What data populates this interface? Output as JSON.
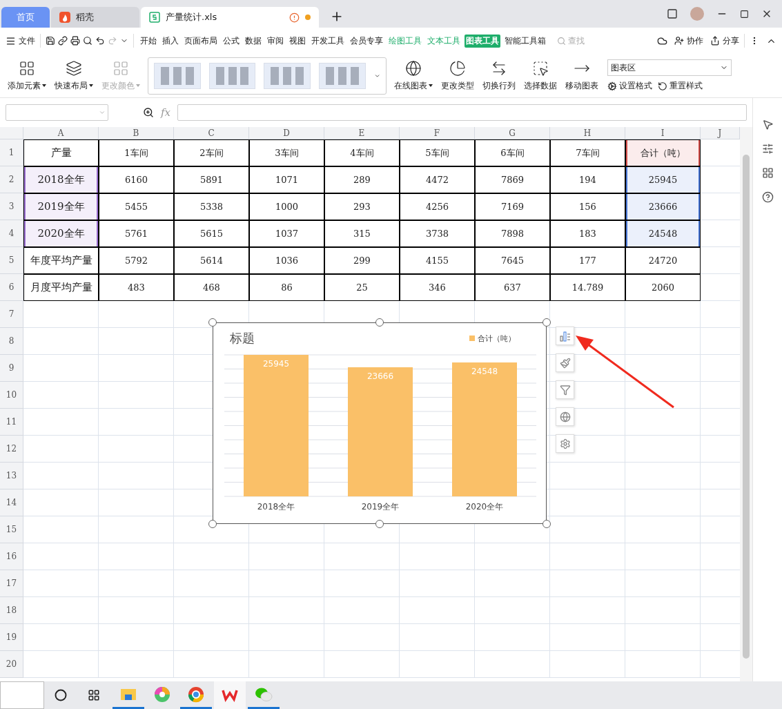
{
  "tabs": [
    {
      "label": "首页",
      "kind": "home",
      "selected": false
    },
    {
      "label": "稻壳",
      "kind": "app",
      "selected": false
    },
    {
      "label": "产量统计.xls",
      "kind": "document",
      "selected": true,
      "modified": true
    }
  ],
  "menu": {
    "file": "文件",
    "items": [
      {
        "label": "开始",
        "kind": "normal",
        "selected": false
      },
      {
        "label": "插入",
        "kind": "normal",
        "selected": false
      },
      {
        "label": "页面布局",
        "kind": "normal",
        "selected": false
      },
      {
        "label": "公式",
        "kind": "normal",
        "selected": false
      },
      {
        "label": "数据",
        "kind": "normal",
        "selected": false
      },
      {
        "label": "审阅",
        "kind": "normal",
        "selected": false
      },
      {
        "label": "视图",
        "kind": "normal",
        "selected": false
      },
      {
        "label": "开发工具",
        "kind": "normal",
        "selected": false
      },
      {
        "label": "会员专享",
        "kind": "normal",
        "selected": false
      },
      {
        "label": "绘图工具",
        "kind": "context",
        "selected": false
      },
      {
        "label": "文本工具",
        "kind": "context",
        "selected": false
      },
      {
        "label": "图表工具",
        "kind": "context",
        "selected": true
      },
      {
        "label": "智能工具箱",
        "kind": "normal",
        "selected": false
      }
    ],
    "search": {
      "placeholder": "查找"
    },
    "actions": [
      "协作",
      "分享"
    ]
  },
  "ribbon": [
    {
      "kind": "large",
      "label": "添加元素",
      "dropdown": true,
      "disabled": false
    },
    {
      "kind": "large",
      "label": "快速布局",
      "dropdown": true,
      "disabled": false
    },
    {
      "kind": "large",
      "label": "更改颜色",
      "dropdown": true,
      "disabled": true
    },
    {
      "kind": "gallery"
    },
    {
      "kind": "large",
      "label": "在线图表",
      "dropdown": true,
      "disabled": false
    },
    {
      "kind": "large",
      "label": "更改类型",
      "dropdown": false,
      "disabled": false
    },
    {
      "kind": "large",
      "label": "切换行列",
      "dropdown": false,
      "disabled": false
    },
    {
      "kind": "large",
      "label": "选择数据",
      "dropdown": false,
      "disabled": false
    },
    {
      "kind": "large",
      "label": "移动图表",
      "dropdown": false,
      "disabled": false
    },
    {
      "kind": "format",
      "select": "图表区",
      "buttons": [
        "设置格式",
        "重置样式"
      ]
    }
  ],
  "formula_bar": {
    "fx": "fx"
  },
  "sheet": {
    "columns": [
      "A",
      "B",
      "C",
      "D",
      "E",
      "F",
      "G",
      "H",
      "I",
      "J"
    ],
    "rows": [
      {
        "number": "1",
        "cells": [
          {
            "text": "产量"
          },
          {
            "text": "1车间"
          },
          {
            "text": "2车间"
          },
          {
            "text": "3车间"
          },
          {
            "text": "4车间"
          },
          {
            "text": "5车间"
          },
          {
            "text": "6车间"
          },
          {
            "text": "7车间"
          },
          {
            "text": "合计（吨）",
            "color": "#d9534f"
          }
        ]
      },
      {
        "number": "2",
        "cells": [
          {
            "text": "2018全年",
            "color": "#9c6fd3"
          },
          {
            "text": "6160"
          },
          {
            "text": "5891"
          },
          {
            "text": "1071"
          },
          {
            "text": "289"
          },
          {
            "text": "4472"
          },
          {
            "text": "7869"
          },
          {
            "text": "194"
          },
          {
            "text": "25945",
            "color": "#4a78d8"
          }
        ]
      },
      {
        "number": "3",
        "cells": [
          {
            "text": "2019全年",
            "color": "#9c6fd3"
          },
          {
            "text": "5455"
          },
          {
            "text": "5338"
          },
          {
            "text": "1000"
          },
          {
            "text": "293"
          },
          {
            "text": "4256"
          },
          {
            "text": "7169"
          },
          {
            "text": "156"
          },
          {
            "text": "23666",
            "color": "#4a78d8"
          }
        ]
      },
      {
        "number": "4",
        "cells": [
          {
            "text": "2020全年",
            "color": "#9c6fd3"
          },
          {
            "text": "5761"
          },
          {
            "text": "5615"
          },
          {
            "text": "1037"
          },
          {
            "text": "315"
          },
          {
            "text": "3738"
          },
          {
            "text": "7898"
          },
          {
            "text": "183"
          },
          {
            "text": "24548",
            "color": "#4a78d8"
          }
        ]
      },
      {
        "number": "5",
        "cells": [
          {
            "text": "年度平均产量"
          },
          {
            "text": "5792"
          },
          {
            "text": "5614"
          },
          {
            "text": "1036"
          },
          {
            "text": "299"
          },
          {
            "text": "4155"
          },
          {
            "text": "7645"
          },
          {
            "text": "177"
          },
          {
            "text": "24720"
          }
        ]
      },
      {
        "number": "6",
        "cells": [
          {
            "text": "月度平均产量"
          },
          {
            "text": "483"
          },
          {
            "text": "468"
          },
          {
            "text": "86"
          },
          {
            "text": "25"
          },
          {
            "text": "346"
          },
          {
            "text": "637"
          },
          {
            "text": "14.789"
          },
          {
            "text": "2060"
          }
        ]
      },
      {
        "number": "7"
      },
      {
        "number": "8"
      },
      {
        "number": "9"
      },
      {
        "number": "10"
      },
      {
        "number": "11"
      },
      {
        "number": "12"
      },
      {
        "number": "13"
      },
      {
        "number": "14"
      },
      {
        "number": "15"
      },
      {
        "number": "16"
      },
      {
        "number": "17"
      },
      {
        "number": "18"
      },
      {
        "number": "19"
      },
      {
        "number": "20"
      }
    ]
  },
  "chart": {
    "chart_data": {
      "type": "bar",
      "title": "标题",
      "categories": [
        "2018全年",
        "2019全年",
        "2020全年"
      ],
      "series": [
        {
          "name": "合计（吨）",
          "color": "#fac068",
          "values": [
            25945,
            23666,
            24548
          ]
        }
      ],
      "data_labels": true
    }
  },
  "taskbar": {
    "apps": [
      {
        "running": true,
        "selected": false
      },
      {
        "running": false,
        "selected": false
      },
      {
        "running": true,
        "selected": false
      },
      {
        "running": false,
        "selected": true
      },
      {
        "running": true,
        "selected": false
      }
    ]
  }
}
